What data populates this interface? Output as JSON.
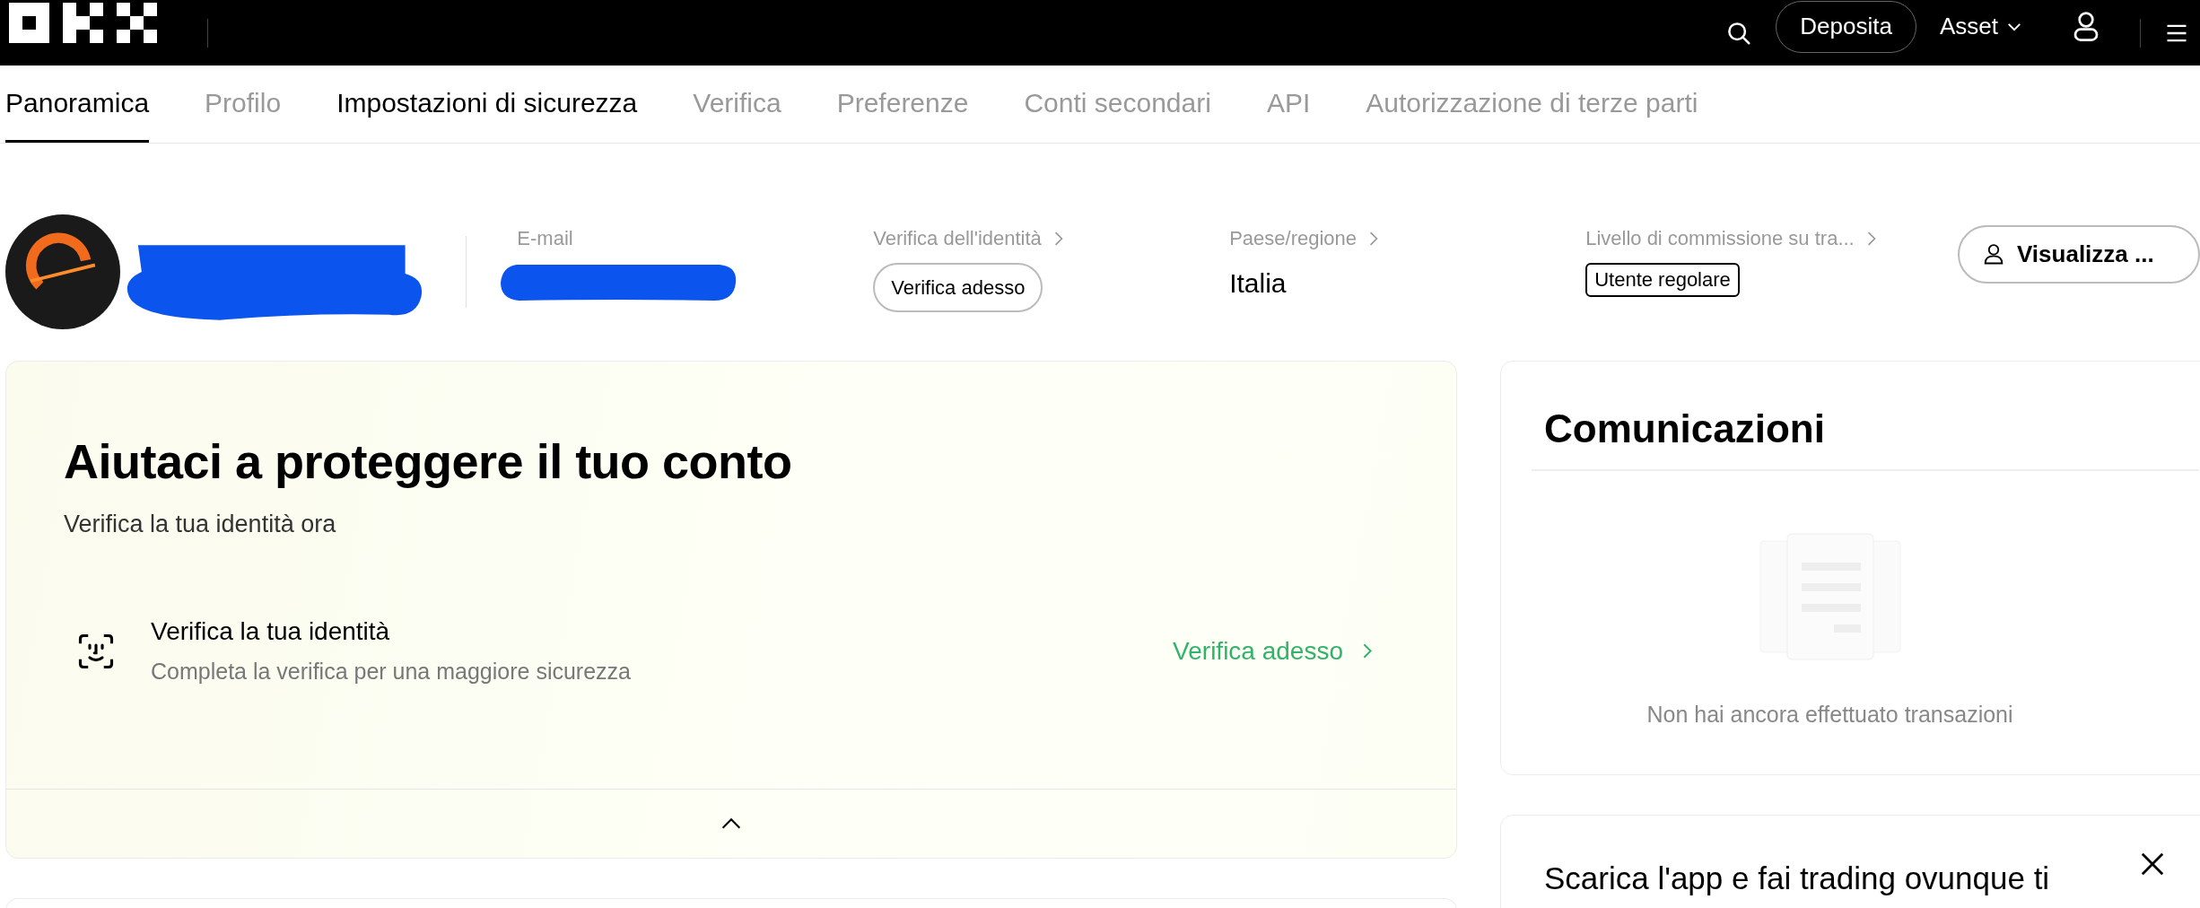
{
  "top_bar": {
    "deposit_button": "Deposita",
    "asset_menu": "Asset"
  },
  "tabs": [
    {
      "label": "Panoramica",
      "selected": true
    },
    {
      "label": "Profilo",
      "selected": false
    },
    {
      "label": "Impostazioni di sicurezza",
      "selected": false,
      "emphasized": true
    },
    {
      "label": "Verifica",
      "selected": false
    },
    {
      "label": "Preferenze",
      "selected": false
    },
    {
      "label": "Conti secondari",
      "selected": false
    },
    {
      "label": "API",
      "selected": false
    },
    {
      "label": "Autorizzazione di terze parti",
      "selected": false
    }
  ],
  "profile": {
    "name": {
      "redacted": true
    },
    "email": {
      "label": "E-mail",
      "redacted": true
    },
    "identity": {
      "label": "Verifica dell'identità",
      "button": "Verifica adesso"
    },
    "country": {
      "label": "Paese/regione",
      "value": "Italia"
    },
    "fee_level": {
      "label": "Livello di commissione su tra...",
      "tag": "Utente regolare"
    },
    "view_button": "Visualizza ..."
  },
  "security_card": {
    "title": "Aiutaci a proteggere il tuo conto",
    "subtitle": "Verifica la tua identità ora",
    "expanded": true,
    "items": [
      {
        "title": "Verifica la tua identità",
        "description": "Completa la verifica per una maggiore sicurezza",
        "action": "Verifica adesso"
      }
    ]
  },
  "announcements": {
    "title": "Comunicazioni",
    "empty_message": "Non hai ancora effettuato transazioni"
  },
  "app_promo": {
    "title": "Scarica l'app e fai trading ovunque ti"
  }
}
